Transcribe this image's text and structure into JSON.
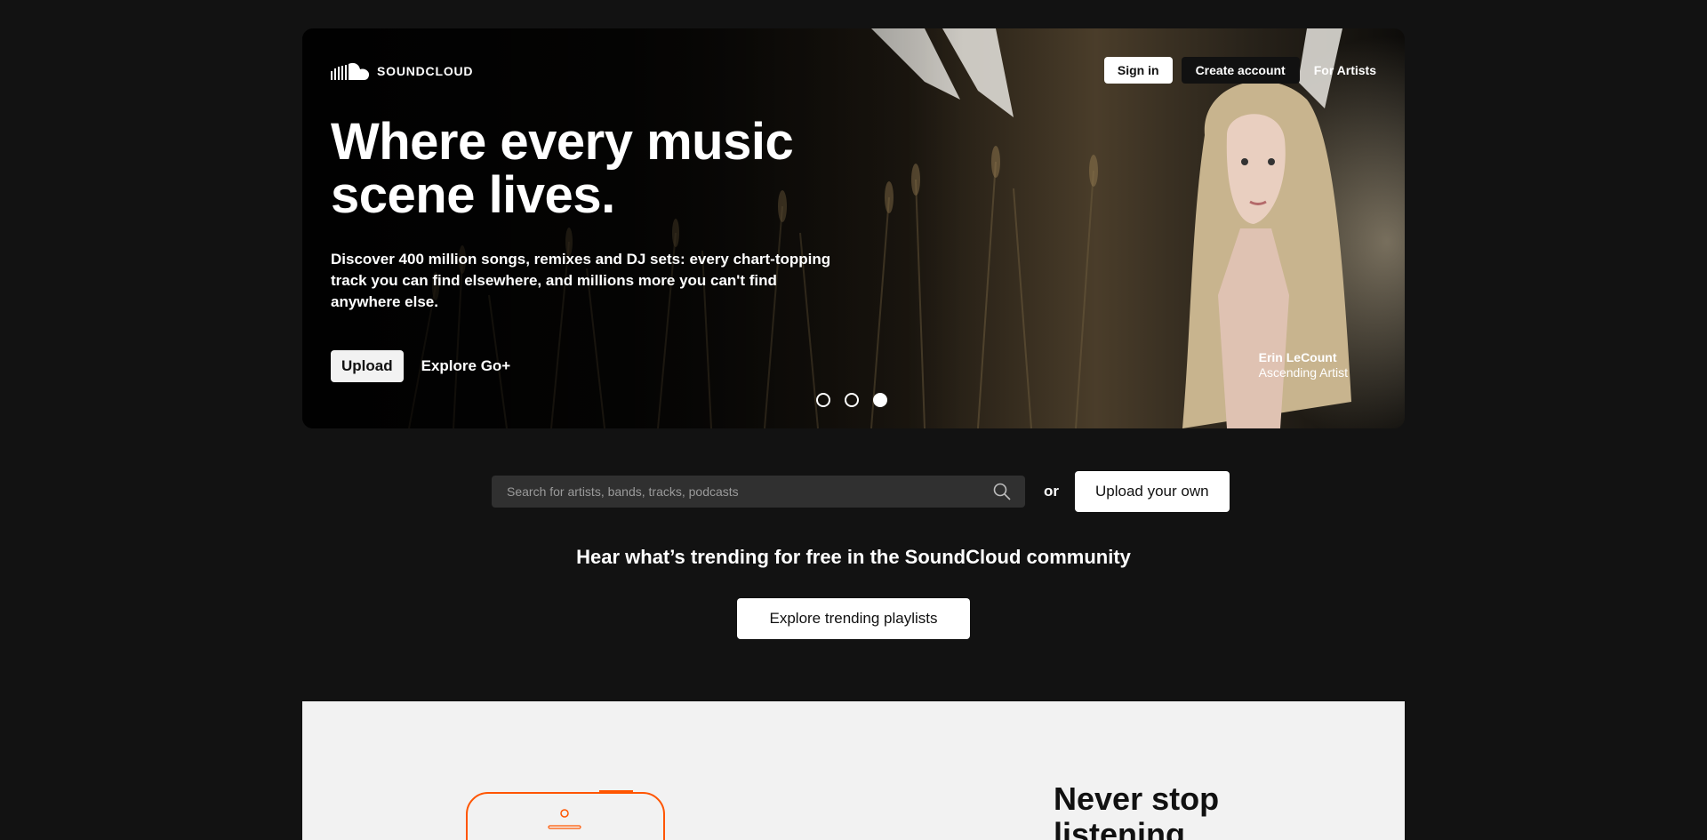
{
  "brand": {
    "name": "SOUNDCLOUD",
    "icon": "soundcloud-cloud-icon"
  },
  "nav": {
    "signin": "Sign in",
    "create_account": "Create account",
    "for_artists": "For Artists"
  },
  "hero": {
    "headline": "Where every music scene lives.",
    "subtext": "Discover 400 million songs, remixes and DJ sets: every chart-topping track you can find elsewhere, and millions more you can't find anywhere else.",
    "upload": "Upload",
    "explore_goplus": "Explore Go+",
    "carousel": {
      "count": 3,
      "active_index": 2
    },
    "credit": {
      "name": "Erin LeCount",
      "role": "Ascending Artist"
    }
  },
  "search": {
    "placeholder": "Search for artists, bands, tracks, podcasts",
    "icon": "search-icon"
  },
  "or_label": "or",
  "upload_own": "Upload your own",
  "trending": {
    "heading": "Hear what’s trending for free in the SoundCloud community",
    "button": "Explore trending playlists"
  },
  "promo": {
    "heading": "Never stop listening"
  },
  "colors": {
    "page_bg": "#121212",
    "accent": "#ff5500",
    "panel_bg": "#f2f2f2"
  }
}
